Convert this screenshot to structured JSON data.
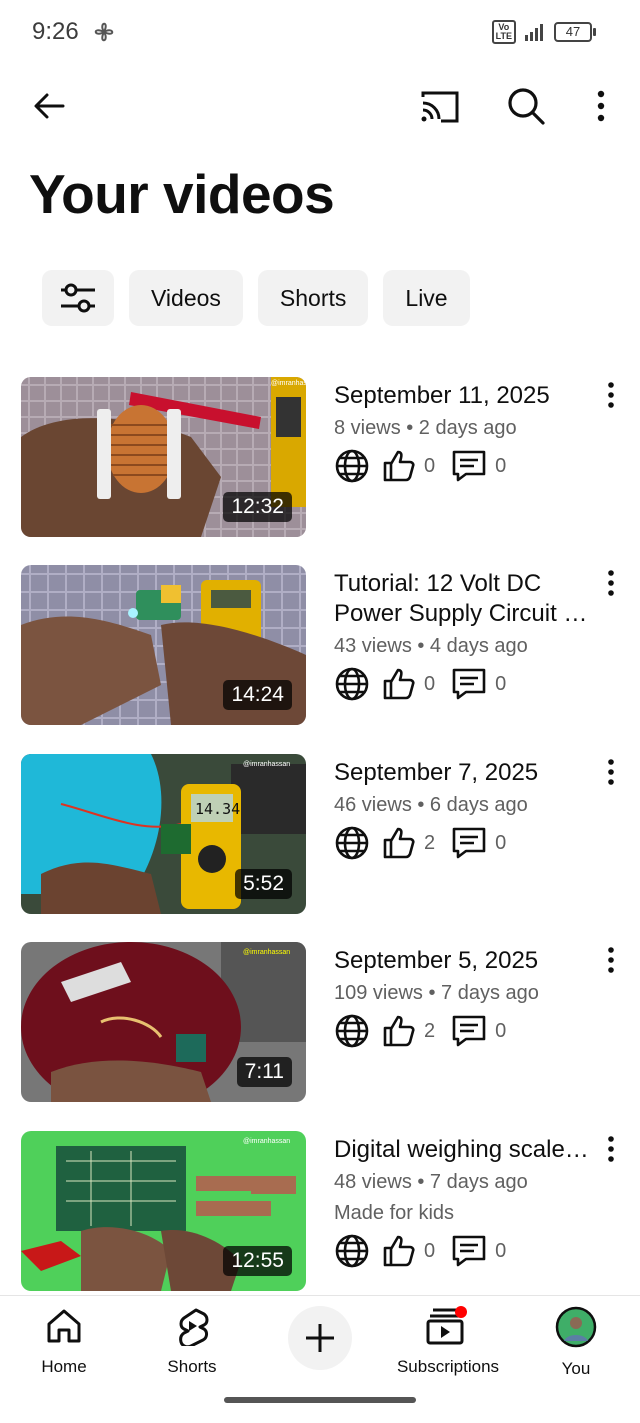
{
  "status_bar": {
    "time": "9:26",
    "volte_line1": "Vo",
    "volte_line2": "LTE",
    "battery": "47"
  },
  "header": {
    "title": "Your videos"
  },
  "filters": [
    {
      "label": "Videos"
    },
    {
      "label": "Shorts"
    },
    {
      "label": "Live"
    }
  ],
  "videos": [
    {
      "title": "September 11, 2025",
      "meta": "8 views • 2 days ago",
      "duration": "12:32",
      "likes": "0",
      "comments": "0",
      "kids": ""
    },
    {
      "title": "Tutorial: 12 Volt DC Power Supply Circuit …",
      "meta": "43 views • 4 days ago",
      "duration": "14:24",
      "likes": "0",
      "comments": "0",
      "kids": ""
    },
    {
      "title": "September 7, 2025",
      "meta": "46 views • 6 days ago",
      "duration": "5:52",
      "likes": "2",
      "comments": "0",
      "kids": ""
    },
    {
      "title": "September 5, 2025",
      "meta": "109 views • 7 days ago",
      "duration": "7:11",
      "likes": "2",
      "comments": "0",
      "kids": ""
    },
    {
      "title": "Digital weighing scale…",
      "meta": "48 views • 7 days ago",
      "duration": "12:55",
      "likes": "0",
      "comments": "0",
      "kids": "Made for kids"
    }
  ],
  "thumbnail_text": {
    "watermark": "@imranhassan",
    "meter_reading": "14.34"
  },
  "nav": {
    "home": "Home",
    "shorts": "Shorts",
    "subscriptions": "Subscriptions",
    "you": "You"
  },
  "colors": {
    "accent_red": "#ff0000",
    "chip_bg": "#f2f2f2",
    "text_secondary": "#606060"
  }
}
